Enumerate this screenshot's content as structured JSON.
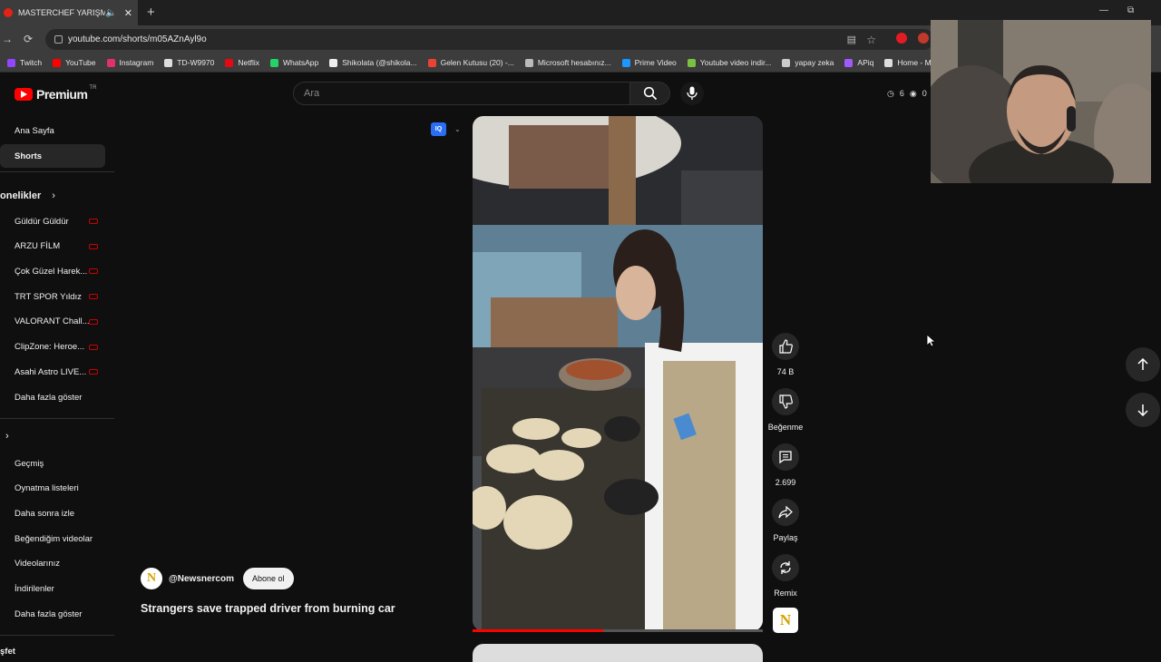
{
  "browser": {
    "tab_title": "MASTERCHEF YARIŞMACILA",
    "new_tab_symbol": "+",
    "url": "youtube.com/shorts/m05AZnAyl9o"
  },
  "bookmarks": [
    {
      "label": "Twitch",
      "color": "#9146ff"
    },
    {
      "label": "YouTube",
      "color": "#ff0000"
    },
    {
      "label": "Instagram",
      "color": "#e1306c"
    },
    {
      "label": "TD-W9970",
      "color": "#dddddd"
    },
    {
      "label": "Netflix",
      "color": "#e50914"
    },
    {
      "label": "WhatsApp",
      "color": "#25d366"
    },
    {
      "label": "Shikolata (@shikola...",
      "color": "#eeeeee"
    },
    {
      "label": "Gelen Kutusu (20) -...",
      "color": "#ea4335"
    },
    {
      "label": "Microsoft hesabınız...",
      "color": "#bbbbbb"
    },
    {
      "label": "Prime Video",
      "color": "#1a98ff"
    },
    {
      "label": "Youtube video indir...",
      "color": "#7ac142"
    },
    {
      "label": "yapay zeka",
      "color": "#cccccc"
    },
    {
      "label": "APiq",
      "color": "#a259ff"
    },
    {
      "label": "Home - Mar",
      "color": "#dddddd"
    }
  ],
  "youtube": {
    "logo_text": "Premium",
    "logo_region": "TR",
    "search_placeholder": "Ara",
    "counter_a": "6",
    "counter_b": "0"
  },
  "sidebar": {
    "top_items": [
      "Ana Sayfa",
      "Shorts"
    ],
    "subscriptions_heading": "onelikler",
    "subscriptions": [
      "Güldür Güldür",
      "ARZU FİLM",
      "Çok Güzel Harek...",
      "TRT SPOR Yıldız",
      "VALORANT Chall...",
      "ClipZone: Heroe...",
      "Asahi Astro LIVE..."
    ],
    "show_more_1": "Daha fazla göster",
    "you_items": [
      "Geçmiş",
      "Oynatma listeleri",
      "Daha sonra izle",
      "Beğendiğim videolar",
      "Videolarınız",
      "İndirilenler"
    ],
    "show_more_2": "Daha fazla göster",
    "bottom_cut": "şfet"
  },
  "short": {
    "quality_badge": "IQ",
    "progress_fraction": 0.45,
    "channel_handle": "@Newsnercom",
    "channel_initial": "N",
    "subscribe_label": "Abone ol",
    "title": "Strangers save trapped driver from burning car"
  },
  "actions": {
    "like_count": "74 B",
    "dislike_label": "Beğenme",
    "comment_count": "2.699",
    "share_label": "Paylaş",
    "remix_label": "Remix"
  },
  "colors": {
    "accent": "#ff0000",
    "background": "#0f0f0f"
  }
}
